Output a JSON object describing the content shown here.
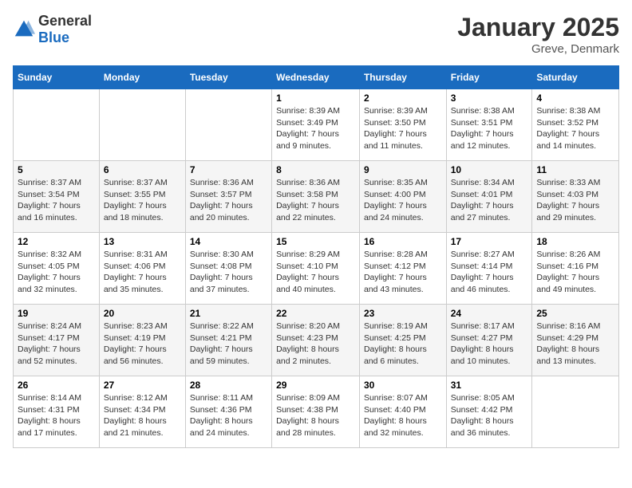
{
  "logo": {
    "general": "General",
    "blue": "Blue"
  },
  "title": "January 2025",
  "subtitle": "Greve, Denmark",
  "weekdays": [
    "Sunday",
    "Monday",
    "Tuesday",
    "Wednesday",
    "Thursday",
    "Friday",
    "Saturday"
  ],
  "weeks": [
    [
      {
        "day": "",
        "content": ""
      },
      {
        "day": "",
        "content": ""
      },
      {
        "day": "",
        "content": ""
      },
      {
        "day": "1",
        "content": "Sunrise: 8:39 AM\nSunset: 3:49 PM\nDaylight: 7 hours\nand 9 minutes."
      },
      {
        "day": "2",
        "content": "Sunrise: 8:39 AM\nSunset: 3:50 PM\nDaylight: 7 hours\nand 11 minutes."
      },
      {
        "day": "3",
        "content": "Sunrise: 8:38 AM\nSunset: 3:51 PM\nDaylight: 7 hours\nand 12 minutes."
      },
      {
        "day": "4",
        "content": "Sunrise: 8:38 AM\nSunset: 3:52 PM\nDaylight: 7 hours\nand 14 minutes."
      }
    ],
    [
      {
        "day": "5",
        "content": "Sunrise: 8:37 AM\nSunset: 3:54 PM\nDaylight: 7 hours\nand 16 minutes."
      },
      {
        "day": "6",
        "content": "Sunrise: 8:37 AM\nSunset: 3:55 PM\nDaylight: 7 hours\nand 18 minutes."
      },
      {
        "day": "7",
        "content": "Sunrise: 8:36 AM\nSunset: 3:57 PM\nDaylight: 7 hours\nand 20 minutes."
      },
      {
        "day": "8",
        "content": "Sunrise: 8:36 AM\nSunset: 3:58 PM\nDaylight: 7 hours\nand 22 minutes."
      },
      {
        "day": "9",
        "content": "Sunrise: 8:35 AM\nSunset: 4:00 PM\nDaylight: 7 hours\nand 24 minutes."
      },
      {
        "day": "10",
        "content": "Sunrise: 8:34 AM\nSunset: 4:01 PM\nDaylight: 7 hours\nand 27 minutes."
      },
      {
        "day": "11",
        "content": "Sunrise: 8:33 AM\nSunset: 4:03 PM\nDaylight: 7 hours\nand 29 minutes."
      }
    ],
    [
      {
        "day": "12",
        "content": "Sunrise: 8:32 AM\nSunset: 4:05 PM\nDaylight: 7 hours\nand 32 minutes."
      },
      {
        "day": "13",
        "content": "Sunrise: 8:31 AM\nSunset: 4:06 PM\nDaylight: 7 hours\nand 35 minutes."
      },
      {
        "day": "14",
        "content": "Sunrise: 8:30 AM\nSunset: 4:08 PM\nDaylight: 7 hours\nand 37 minutes."
      },
      {
        "day": "15",
        "content": "Sunrise: 8:29 AM\nSunset: 4:10 PM\nDaylight: 7 hours\nand 40 minutes."
      },
      {
        "day": "16",
        "content": "Sunrise: 8:28 AM\nSunset: 4:12 PM\nDaylight: 7 hours\nand 43 minutes."
      },
      {
        "day": "17",
        "content": "Sunrise: 8:27 AM\nSunset: 4:14 PM\nDaylight: 7 hours\nand 46 minutes."
      },
      {
        "day": "18",
        "content": "Sunrise: 8:26 AM\nSunset: 4:16 PM\nDaylight: 7 hours\nand 49 minutes."
      }
    ],
    [
      {
        "day": "19",
        "content": "Sunrise: 8:24 AM\nSunset: 4:17 PM\nDaylight: 7 hours\nand 52 minutes."
      },
      {
        "day": "20",
        "content": "Sunrise: 8:23 AM\nSunset: 4:19 PM\nDaylight: 7 hours\nand 56 minutes."
      },
      {
        "day": "21",
        "content": "Sunrise: 8:22 AM\nSunset: 4:21 PM\nDaylight: 7 hours\nand 59 minutes."
      },
      {
        "day": "22",
        "content": "Sunrise: 8:20 AM\nSunset: 4:23 PM\nDaylight: 8 hours\nand 2 minutes."
      },
      {
        "day": "23",
        "content": "Sunrise: 8:19 AM\nSunset: 4:25 PM\nDaylight: 8 hours\nand 6 minutes."
      },
      {
        "day": "24",
        "content": "Sunrise: 8:17 AM\nSunset: 4:27 PM\nDaylight: 8 hours\nand 10 minutes."
      },
      {
        "day": "25",
        "content": "Sunrise: 8:16 AM\nSunset: 4:29 PM\nDaylight: 8 hours\nand 13 minutes."
      }
    ],
    [
      {
        "day": "26",
        "content": "Sunrise: 8:14 AM\nSunset: 4:31 PM\nDaylight: 8 hours\nand 17 minutes."
      },
      {
        "day": "27",
        "content": "Sunrise: 8:12 AM\nSunset: 4:34 PM\nDaylight: 8 hours\nand 21 minutes."
      },
      {
        "day": "28",
        "content": "Sunrise: 8:11 AM\nSunset: 4:36 PM\nDaylight: 8 hours\nand 24 minutes."
      },
      {
        "day": "29",
        "content": "Sunrise: 8:09 AM\nSunset: 4:38 PM\nDaylight: 8 hours\nand 28 minutes."
      },
      {
        "day": "30",
        "content": "Sunrise: 8:07 AM\nSunset: 4:40 PM\nDaylight: 8 hours\nand 32 minutes."
      },
      {
        "day": "31",
        "content": "Sunrise: 8:05 AM\nSunset: 4:42 PM\nDaylight: 8 hours\nand 36 minutes."
      },
      {
        "day": "",
        "content": ""
      }
    ]
  ]
}
